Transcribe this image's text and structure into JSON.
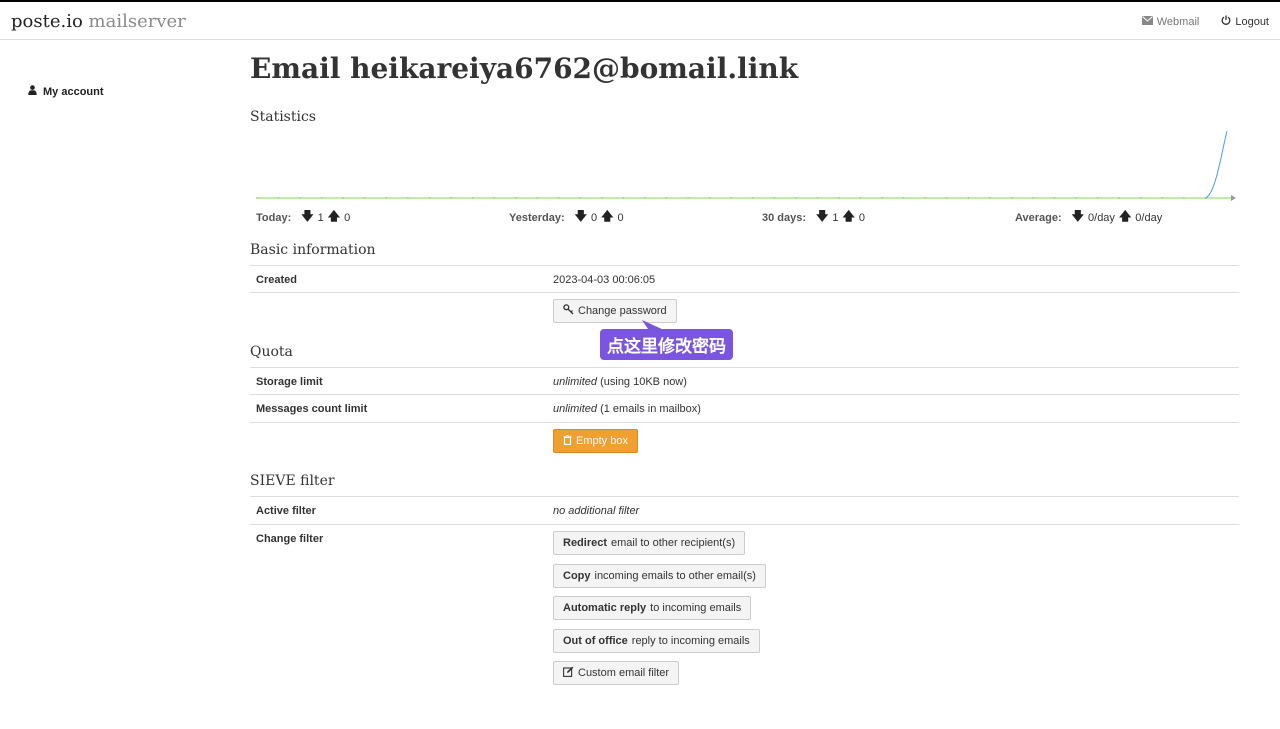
{
  "header": {
    "brand_main": "poste.io",
    "brand_sub": "mailserver",
    "nav": {
      "webmail_label": "Webmail",
      "logout_label": "Logout"
    }
  },
  "sidebar": {
    "items": [
      {
        "label": "My account",
        "icon": "user-icon"
      }
    ]
  },
  "main": {
    "title": "Email heikareiya6762@bomail.link",
    "statistics": {
      "title": "Statistics",
      "today": {
        "label": "Today:",
        "in": "1",
        "out": "0"
      },
      "yesterday": {
        "label": "Yesterday:",
        "in": "0",
        "out": "0"
      },
      "days30": {
        "label": "30 days:",
        "in": "1",
        "out": "0"
      },
      "average": {
        "label": "Average:",
        "in": "0/day",
        "out": "0/day"
      }
    },
    "basic": {
      "title": "Basic information",
      "created_label": "Created",
      "created_value": "2023-04-03 00:06:05",
      "change_password_label": "Change password"
    },
    "annotation": {
      "text": "点这里修改密码",
      "color": "#7a55e0"
    },
    "quota": {
      "title": "Quota",
      "storage_label": "Storage limit",
      "storage_value_em": "unlimited",
      "storage_value_rest": "(using 10KB now)",
      "messages_label": "Messages count limit",
      "messages_value_em": "unlimited",
      "messages_value_rest": "(1 emails in mailbox)",
      "empty_box_label": "Empty box"
    },
    "sieve": {
      "title": "SIEVE filter",
      "active_label": "Active filter",
      "active_value": "no additional filter",
      "change_label": "Change filter",
      "buttons": [
        {
          "bold": "Redirect",
          "rest": "email to other recipient(s)"
        },
        {
          "bold": "Copy",
          "rest": "incoming emails to other email(s)"
        },
        {
          "bold": "Automatic reply",
          "rest": "to incoming emails"
        },
        {
          "bold": "Out of office",
          "rest": "reply to incoming emails"
        },
        {
          "bold": "",
          "rest": "Custom email filter"
        }
      ]
    }
  },
  "colors": {
    "chart_baseline": "#7ed957",
    "chart_spike": "#4aa3df",
    "warning": "#f0a030"
  },
  "chart_data": {
    "type": "line",
    "series": [
      {
        "values": [
          0,
          0,
          0,
          0,
          0,
          0,
          0,
          0,
          0,
          0,
          0,
          0,
          0,
          0,
          0,
          0,
          0,
          0,
          0,
          0,
          0,
          0,
          0,
          0,
          0,
          0,
          0,
          0,
          0,
          0,
          0,
          0,
          0,
          0,
          0,
          0,
          0,
          0,
          0,
          0,
          0,
          0,
          0,
          0,
          0,
          1
        ]
      }
    ],
    "grid": false,
    "legend": "none"
  }
}
